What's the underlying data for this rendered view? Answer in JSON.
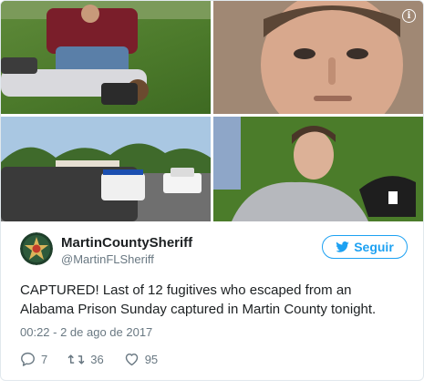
{
  "photos": [
    {
      "description": "arrest-on-grass"
    },
    {
      "description": "mugshot-closeup"
    },
    {
      "description": "street-with-police-vehicles"
    },
    {
      "description": "suspect-selfie-on-grass"
    }
  ],
  "author": {
    "display_name": "MartinCountySheriff",
    "handle": "@MartinFLSheriff",
    "avatar_icon": "sheriff-star-badge-icon"
  },
  "follow_label": "Seguir",
  "tweet_text": "CAPTURED! Last of 12 fugitives who escaped from an Alabama Prison Sunday captured in Martin County tonight.",
  "timestamp": "00:22 - 2 de ago de 2017",
  "actions": {
    "replies": "7",
    "retweets": "36",
    "likes": "95"
  },
  "colors": {
    "accent": "#1da1f2",
    "muted": "#697882",
    "text": "#1c2022",
    "border": "#e1e8ed"
  }
}
